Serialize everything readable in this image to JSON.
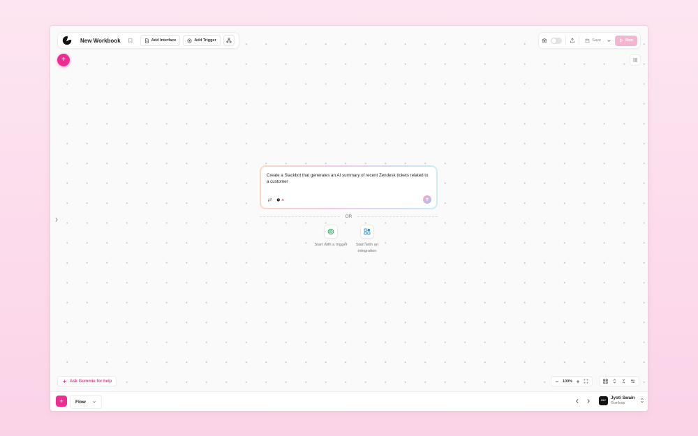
{
  "header": {
    "workbook_title": "New Workbook",
    "add_interface_label": "Add Interface",
    "add_trigger_label": "Add Trigger",
    "save_label": "Save",
    "run_label": "Run"
  },
  "prompt": {
    "text": "Create a Slackbot that generates an AI summary of recent Zendesk tickets related to a customer"
  },
  "divider": {
    "or_label": "OR"
  },
  "start_options": [
    {
      "label": "Start with a trigger",
      "icon": "trigger-icon"
    },
    {
      "label": "Start with an integration",
      "icon": "integration-icon"
    }
  ],
  "help": {
    "ask_label": "Ask Gummie for help"
  },
  "zoom": {
    "level": "100%"
  },
  "bottom": {
    "flow_label": "Flow",
    "user_name": "Jyoti Swain",
    "user_org": "Gumloop",
    "avatar_text": "GMLP"
  },
  "colors": {
    "accent": "#ee2d92",
    "run_disabled": "#f6b4d3",
    "ask_text": "#e33c8e"
  }
}
